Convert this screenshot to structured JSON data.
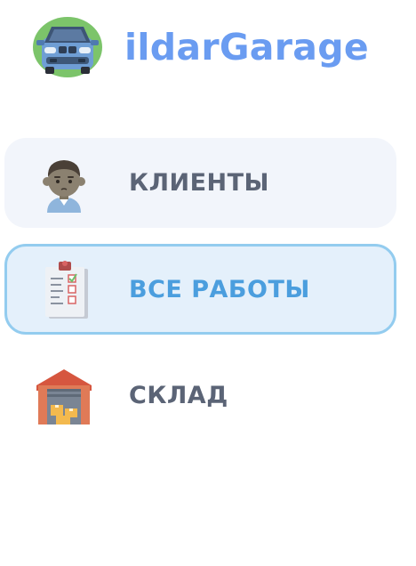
{
  "app": {
    "title": "ildarGarage",
    "logo_icon": "car-icon"
  },
  "colors": {
    "brand": "#6a9cf1",
    "active_text": "#4b9ede",
    "active_border": "#93ccef",
    "active_bg": "#e4f0fb",
    "item_bg": "#f2f5fb",
    "text": "#5b6476"
  },
  "menu": {
    "items": [
      {
        "label": "КЛИЕНТЫ",
        "icon": "person-avatar-icon",
        "active": false
      },
      {
        "label": "ВСЕ РАБОТЫ",
        "icon": "clipboard-checklist-icon",
        "active": true
      },
      {
        "label": "СКЛАД",
        "icon": "warehouse-icon",
        "active": false
      }
    ]
  }
}
